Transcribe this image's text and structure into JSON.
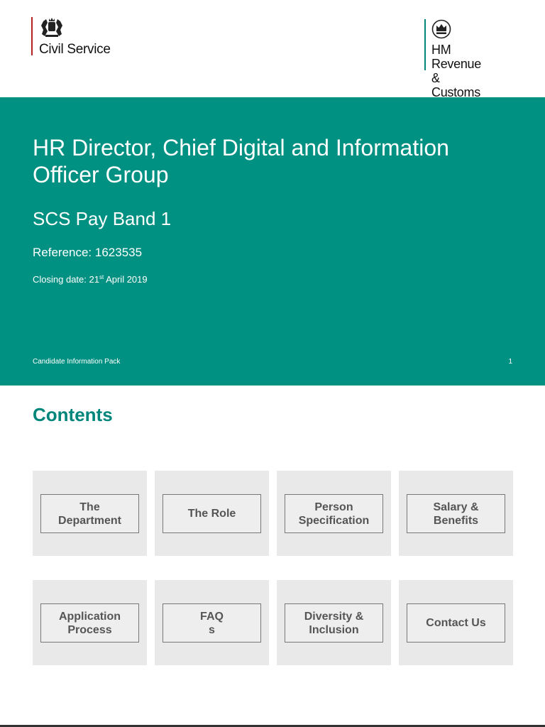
{
  "header": {
    "civil_service_label": "Civil Service",
    "hmrc_label": "HM Revenue\n& Customs",
    "colors": {
      "cs_rule": "#b22222",
      "hmrc_rule": "#00857a"
    }
  },
  "banner": {
    "title": "HR Director, Chief Digital and Information Officer Group",
    "pay_band": "SCS Pay Band 1",
    "reference": "Reference: 1623535",
    "closing_prefix": "Closing date: 21",
    "closing_sup": "st",
    "closing_suffix": " April 2019",
    "footer_label": "Candidate Information Pack",
    "page_number": "1",
    "color": "#009182"
  },
  "contents": {
    "heading": "Contents",
    "tiles": [
      {
        "label": "The\nDepartment"
      },
      {
        "label": "The Role"
      },
      {
        "label": "Person\nSpecification"
      },
      {
        "label": "Salary &\nBenefits"
      },
      {
        "label": "Application\nProcess"
      },
      {
        "label": "FAQ\ns"
      },
      {
        "label": "Diversity &\nInclusion"
      },
      {
        "label": "Contact Us"
      }
    ]
  }
}
